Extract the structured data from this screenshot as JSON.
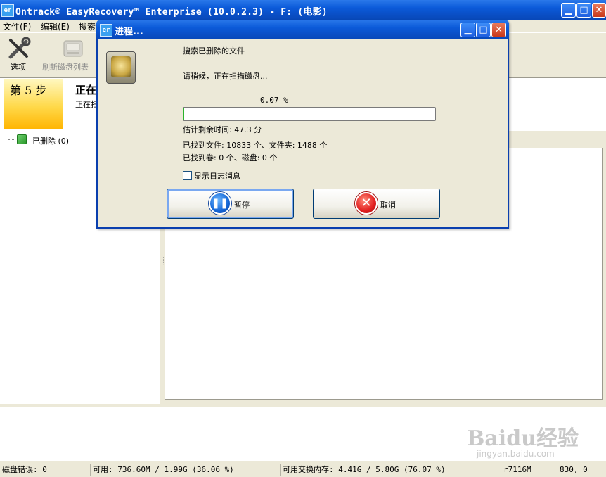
{
  "window": {
    "title": "Ontrack® EasyRecovery™ Enterprise (10.0.2.3) - F: (电影)",
    "icon_text": "er",
    "minimize_glyph": "▁",
    "maximize_glyph": "□",
    "close_glyph": "✕"
  },
  "menu": {
    "items": [
      {
        "label": "文件(F)"
      },
      {
        "label": "编辑(E)"
      },
      {
        "label": "搜索"
      }
    ]
  },
  "toolbar": {
    "options_label": "选项",
    "options_icon": "tools-icon",
    "refresh_label": "刷新磁盘列表",
    "refresh_icon": "disk-icon"
  },
  "step": {
    "label": "第 5 步",
    "title": "正在",
    "desc": "正在扫"
  },
  "tree": {
    "item_label": "已删除 (0)",
    "item_icon": "folder-icon"
  },
  "dialog": {
    "title": "进程...",
    "icon_text": "er",
    "minimize_glyph": "▁",
    "maximize_glyph": "□",
    "close_glyph": "✕",
    "heading": "搜索已删除的文件",
    "status": "请稍候，正在扫描磁盘...",
    "progress_text": "0.07 %",
    "progress_fraction": 0.0007,
    "remaining": "估计剩余时间: 47.3 分",
    "found_files": "已找到文件: 10833 个、文件夹: 1488 个",
    "found_volumes": "已找到卷: 0 个、磁盘: 0 个",
    "show_log_label": "显示日志消息",
    "pause_label": "暂停",
    "cancel_label": "取消",
    "pause_glyph": "❚❚",
    "cancel_glyph": "✕"
  },
  "statusbar": {
    "disk_errors": "磁盘错误: 0",
    "available": "可用: 736.60M / 1.99G (36.06 %)",
    "swap": "可用交换内存: 4.41G / 5.80G (76.07 %)",
    "mem": "r7116M",
    "coords": "830, 0"
  },
  "watermark": {
    "text": "Baidu经验",
    "sub": "jingyan.baidu.com"
  },
  "colors": {
    "titlebar_blue": "#0b5ad9",
    "progress_green": "#2bb32b",
    "step_badge_yellow": "#ffd94a"
  }
}
